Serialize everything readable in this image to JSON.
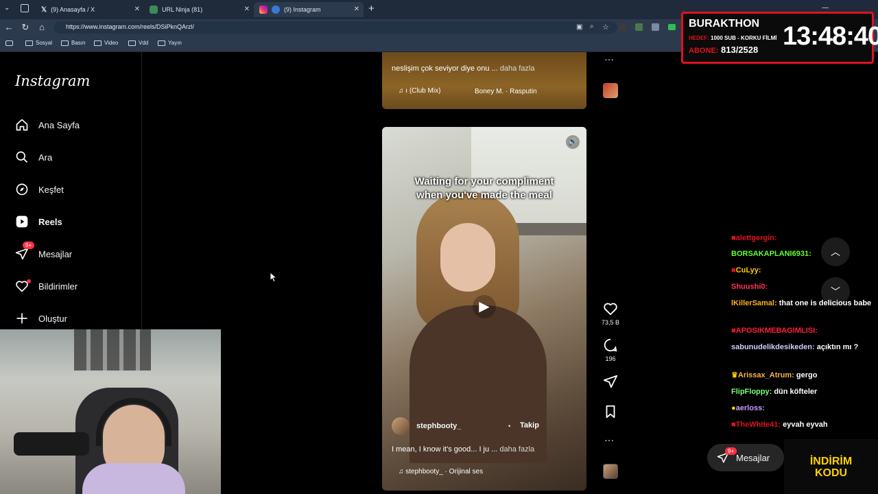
{
  "browser": {
    "tabs": [
      {
        "label": "(9) Anasayfa / X",
        "active": false
      },
      {
        "label": "URL Ninja (81)",
        "active": false
      },
      {
        "label": "(9) Instagram",
        "active": true
      }
    ],
    "new_tab": "+",
    "url": "https://www.instagram.com/reels/DSiPknQArzl/",
    "bookmarks": [
      "Sosyal",
      "Basın",
      "Video",
      "Vdd",
      "Yayın"
    ]
  },
  "instagram": {
    "logo": "Instagram",
    "nav": [
      {
        "label": "Ana Sayfa",
        "icon": "home-icon"
      },
      {
        "label": "Ara",
        "icon": "search-icon"
      },
      {
        "label": "Keşfet",
        "icon": "compass-icon"
      },
      {
        "label": "Reels",
        "icon": "reels-icon",
        "active": true
      },
      {
        "label": "Mesajlar",
        "icon": "messenger-icon",
        "badge": "9+"
      },
      {
        "label": "Bildirimler",
        "icon": "heart-icon"
      },
      {
        "label": "Oluştur",
        "icon": "plus-icon"
      }
    ],
    "prev_reel": {
      "caption": "neslişim çok seviyor diye onu ...",
      "more": "daha fazla",
      "audio_title": "ı (Club Mix)",
      "audio_artist": "Boney M. · Rasputin"
    },
    "reel": {
      "overlay_text_line1": "Waiting for your compliment",
      "overlay_text_line2": "when you've made the meal",
      "username": "stephbooty_",
      "follow": "Takip",
      "caption": "I mean, I know it's good... I ju ...",
      "more": "daha fazla",
      "audio": "stephbooty_ · Orijinal ses",
      "likes": "73,5 B",
      "comments": "196"
    },
    "messages_pill": {
      "label": "Mesajlar",
      "badge": "9+"
    }
  },
  "stream": {
    "title": "BURAKTHON",
    "goal_label": "HEDEF:",
    "goal_text": "1000 SUB - KORKU FİLMİ",
    "subs_label": "ABONE:",
    "subs_value": "813/2528",
    "timer": "13:48:40",
    "promo_line1": "İNDİRİM",
    "promo_line2": "KODU"
  },
  "chat": [
    {
      "user": "alettgergin:",
      "msg": "",
      "color": "#e0121f"
    },
    {
      "user": "BORSAKAPLANI6931:",
      "msg": "",
      "color": "#66ff33"
    },
    {
      "user": "CuLyy:",
      "msg": "",
      "color": "#ffcc00"
    },
    {
      "user": "Shuushi0:",
      "msg": "",
      "color": "#ff3355"
    },
    {
      "user": "lKillerSamal:",
      "msg": "that one is delicious babe",
      "color": "#ffb020"
    },
    {
      "user": "APOSIKMEBAGIMLISI:",
      "msg": "",
      "color": "#ff2040"
    },
    {
      "user": "sabunudelikdesikeden:",
      "msg": "açıktın mı ?",
      "color": "#cfcfff"
    },
    {
      "user": "Arissax_Atrum:",
      "msg": "gergo",
      "color": "#ffb347"
    },
    {
      "user": "FlipFloppy:",
      "msg": "dün köfteler",
      "color": "#7cff7c"
    },
    {
      "user": "aerloss:",
      "msg": "",
      "color": "#c79cff"
    },
    {
      "user": "TheWhite41:",
      "msg": "eyvah eyvah",
      "color": "#e0121f"
    }
  ],
  "colors": {
    "accent": "#e0121f",
    "ig_badge": "#ff3040"
  }
}
